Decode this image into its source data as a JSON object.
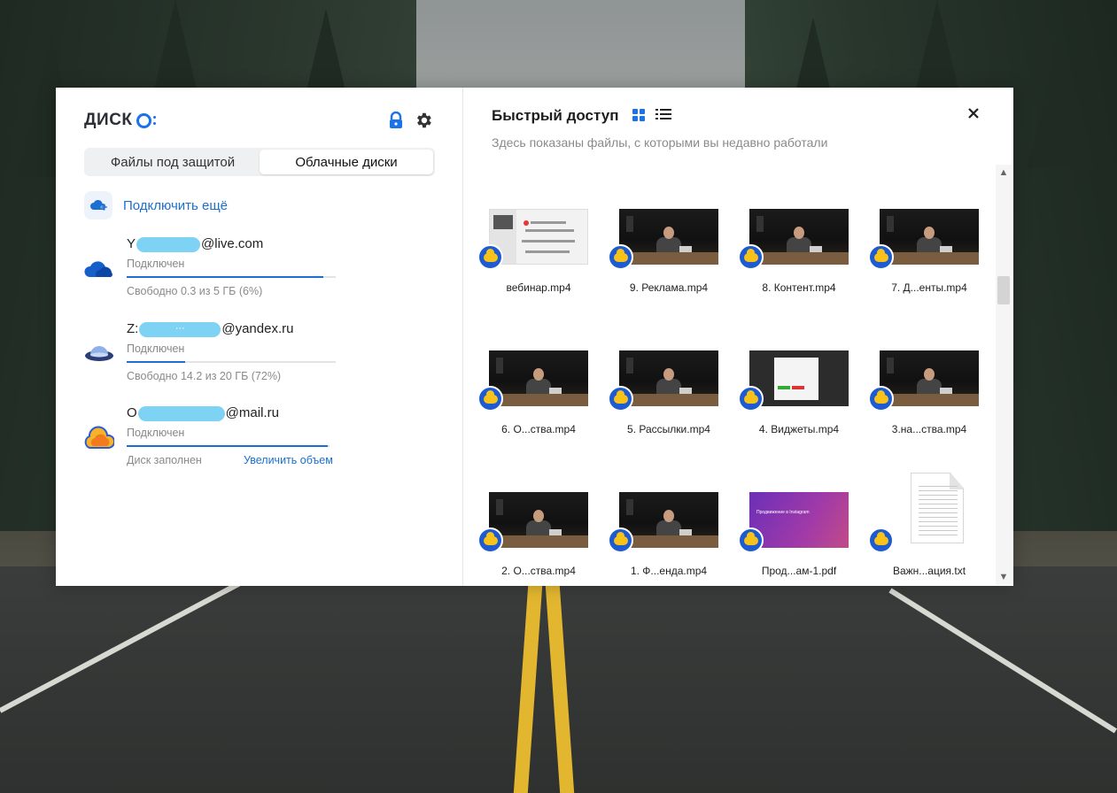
{
  "app": {
    "logo_text": "ДИСК",
    "brand_color": "#1a73e8"
  },
  "tabs": [
    {
      "label": "Файлы под защитой",
      "active": false
    },
    {
      "label": "Облачные диски",
      "active": true
    }
  ],
  "connect_more": {
    "label": "Подключить ещё",
    "icon": "cloud-plus-icon"
  },
  "accounts": [
    {
      "email_prefix": "Y",
      "email_suffix": "@live.com",
      "service": "onedrive",
      "icon": "onedrive-cloud-icon",
      "status": "Подключен",
      "usage_fraction": 0.94,
      "free_text": "Свободно 0.3 из 5 ГБ (6%)",
      "action": ""
    },
    {
      "email_prefix": "Z:",
      "email_suffix": "@yandex.ru",
      "email_mask_dots": "···",
      "service": "yandex",
      "icon": "yandex-disk-icon",
      "status": "Подключен",
      "usage_fraction": 0.28,
      "free_text": "Свободно 14.2 из 20 ГБ (72%)",
      "action": ""
    },
    {
      "email_prefix": "O",
      "email_suffix": "@mail.ru",
      "service": "mailru",
      "icon": "mailru-cloud-icon",
      "status": "Подключен",
      "usage_fraction": 0.99,
      "free_text": "Диск заполнен",
      "action": "Увеличить объем"
    }
  ],
  "quick_access": {
    "title": "Быстрый доступ",
    "subtitle": "Здесь показаны файлы, с которыми вы недавно работали",
    "view_mode": "grid",
    "files": [
      {
        "name": "вебинар.mp4",
        "kind": "webinar"
      },
      {
        "name": "9. Реклама.mp4",
        "kind": "video"
      },
      {
        "name": "8. Контент.mp4",
        "kind": "video"
      },
      {
        "name": "7. Д...енты.mp4",
        "kind": "video"
      },
      {
        "name": "6. О...ства.mp4",
        "kind": "video"
      },
      {
        "name": "5. Рассылки.mp4",
        "kind": "video"
      },
      {
        "name": "4. Виджеты.mp4",
        "kind": "widgets"
      },
      {
        "name": "3.на...ства.mp4",
        "kind": "video"
      },
      {
        "name": "2. О...ства.mp4",
        "kind": "video"
      },
      {
        "name": "1. Ф...енда.mp4",
        "kind": "video"
      },
      {
        "name": "Прод...ам-1.pdf",
        "kind": "pdf"
      },
      {
        "name": "Важн...ация.txt",
        "kind": "txt"
      }
    ],
    "pdf_thumb_text": "Продвижение в Instagram"
  },
  "colors": {
    "link": "#1a6fd0",
    "badge": "#1f5bd0",
    "badge_cloud": "#f7c21a",
    "redaction": "#7ed3f4"
  }
}
